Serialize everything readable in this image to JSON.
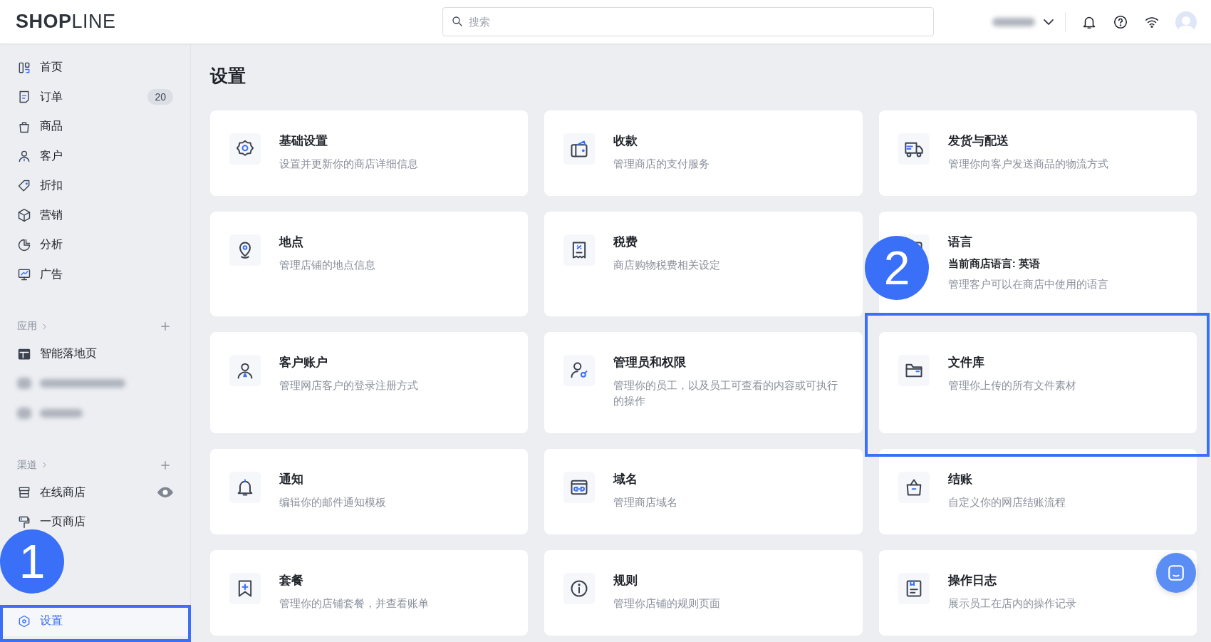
{
  "header": {
    "logo": "**SHOP**LINE",
    "search": {
      "placeholder": "搜索"
    },
    "store_switcher": {
      "kind": "redacted"
    }
  },
  "sidebar": {
    "items": [
      {
        "label": "首页",
        "selected": false
      },
      {
        "label": "订单",
        "badge": "20",
        "selected": false
      },
      {
        "label": "商品",
        "selected": false
      },
      {
        "label": "客户",
        "selected": false
      },
      {
        "label": "折扣",
        "selected": false
      },
      {
        "label": "营销",
        "selected": false
      },
      {
        "label": "分析",
        "selected": false
      },
      {
        "label": "广告",
        "selected": false
      }
    ],
    "sections": [
      {
        "title": "应用",
        "items": [
          {
            "kind": "item",
            "label": "智能落地页",
            "selected": false
          },
          {
            "kind": "redacted"
          },
          {
            "kind": "redacted"
          }
        ]
      },
      {
        "title": "渠道",
        "items": [
          {
            "kind": "item",
            "label": "在线商店",
            "selected": false,
            "eye": true
          },
          {
            "kind": "item",
            "label": "一页商店",
            "selected": false
          }
        ]
      }
    ],
    "settings_item": {
      "label": "设置",
      "selected": true
    }
  },
  "page": {
    "title": "设置",
    "cards": [
      {
        "title": "基础设置",
        "description": "设置并更新你的商店详细信息"
      },
      {
        "title": "收款",
        "description": "管理商店的支付服务"
      },
      {
        "title": "发货与配送",
        "description": "管理你向客户发送商品的物流方式"
      },
      {
        "title": "地点",
        "description": "管理店铺的地点信息"
      },
      {
        "title": "税费",
        "description": "商店购物税费相关设定"
      },
      {
        "title": "语言",
        "detail": "当前商店语言: 英语",
        "description": "管理客户可以在商店中使用的语言"
      },
      {
        "title": "客户账户",
        "description": "管理网店客户的登录注册方式"
      },
      {
        "title": "管理员和权限",
        "description": "管理你的员工，以及员工可查看的内容或可执行的操作"
      },
      {
        "title": "文件库",
        "description": "管理你上传的所有文件素材"
      },
      {
        "title": "通知",
        "description": "编辑你的邮件通知模板"
      },
      {
        "title": "域名",
        "description": "管理商店域名"
      },
      {
        "title": "结账",
        "description": "自定义你的网店结账流程"
      },
      {
        "title": "套餐",
        "description": "管理你的店铺套餐，并查看账单"
      },
      {
        "title": "规则",
        "description": "管理你店铺的规则页面"
      },
      {
        "title": "操作日志",
        "description": "展示员工在店内的操作记录"
      }
    ]
  },
  "annotations": [
    {
      "number": "1"
    },
    {
      "number": "2"
    }
  ]
}
